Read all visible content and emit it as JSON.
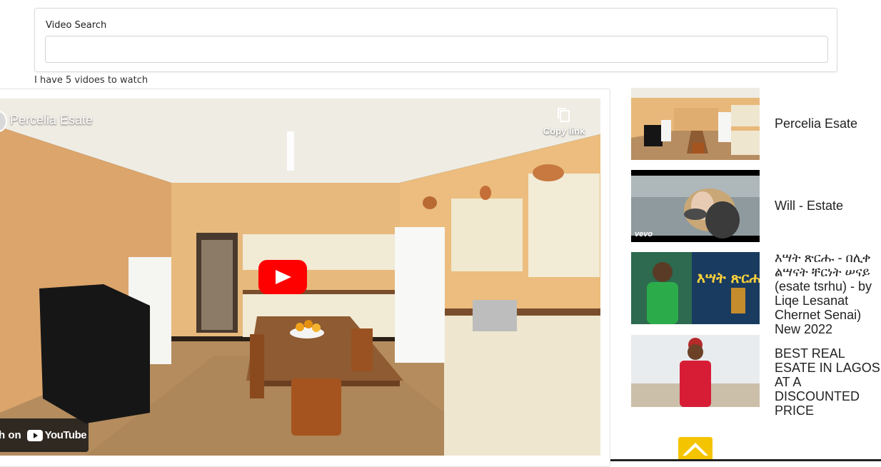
{
  "search": {
    "label": "Video Search",
    "value": "",
    "placeholder": ""
  },
  "video_count_text": "I have 5 vidoes to watch",
  "player": {
    "title": "Percelia Esate",
    "copy_link_label": "Copy link",
    "watch_on_label": "h on",
    "youtube_logo_text": "YouTube"
  },
  "playlist": [
    {
      "title": "Percelia Esate"
    },
    {
      "title": "Will - Estate",
      "badge": "vevo"
    },
    {
      "title": "እሣት ጽርሑ - በሊቀ ልሣናት ቸርነት ሠናይ (esate tsrhu) - by Liqe Lesanat Chernet Senai) New 2022",
      "thumb_caption": "እሣት ጽርሑ"
    },
    {
      "title": "BEST REAL ESATE IN LAGOS AT A DISCOUNTED PRICE"
    }
  ],
  "colors": {
    "youtube_red": "#ff0000",
    "logo_yellow": "#f5c400",
    "wall": "#e9b97a",
    "cabinet": "#efe6cf"
  },
  "icons": [
    "copy-icon",
    "play-icon",
    "youtube-logo-icon",
    "home-logo-icon"
  ]
}
